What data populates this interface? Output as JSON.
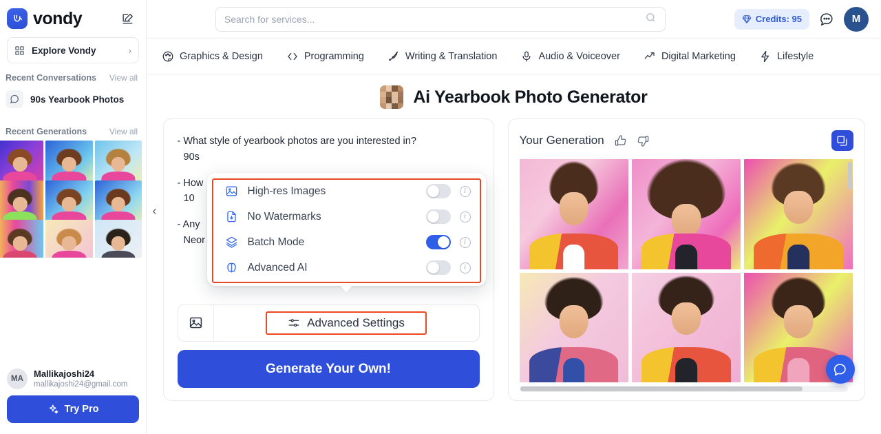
{
  "sidebar": {
    "brand_name": "vondy",
    "compose_icon": "compose-icon",
    "explore": {
      "label": "Explore Vondy",
      "icon": "grid-icon",
      "chevron": "›"
    },
    "recent_conversations": {
      "title": "Recent Conversations",
      "view_all": "View all"
    },
    "conversations": [
      {
        "label": "90s Yearbook Photos",
        "icon": "chat-bubble-icon"
      }
    ],
    "recent_generations": {
      "title": "Recent Generations",
      "view_all": "View all"
    },
    "generation_thumbs": [
      {
        "bg": "linear-gradient(135deg,#3b2fd0,#8a3fd8 45%,#e93fa0)",
        "hair": "#8a4a24",
        "jacket": "#e8489c",
        "shirt": "#f2d23a"
      },
      {
        "bg": "linear-gradient(135deg,#2b63d8,#6cc6ee 60%,#f2f6a0)",
        "hair": "#6e3d20",
        "jacket": "#e8489c",
        "shirt": "#e4607f"
      },
      {
        "bg": "linear-gradient(135deg,#6fc3ea,#bfe7f6 55%,#f6f0a6)",
        "hair": "#b4813f",
        "jacket": "#e8489c",
        "shirt": "#2a2a33"
      },
      {
        "bg": "linear-gradient(90deg,#f4c84a,#e8489c 35%,#7b4ad6 70%,#f6a23c)",
        "hair": "#4c3220",
        "jacket": "#8ce05a",
        "shirt": "#8ce05a"
      },
      {
        "bg": "linear-gradient(135deg,#2b63d8,#7fd0f0 55%,#f6f0a6)",
        "hair": "#7a4423",
        "jacket": "#e8489c",
        "shirt": "#f2d23a"
      },
      {
        "bg": "linear-gradient(135deg,#2b63d8,#8fd8f2 60%,#f6f0a6)",
        "hair": "#6b3a1e",
        "jacket": "#e8489c",
        "shirt": "#f2d23a"
      },
      {
        "bg": "linear-gradient(90deg,#f4c84a,#e8489c 40%,#6ec6ef)",
        "hair": "#5a3a22",
        "jacket": "#d9486f",
        "shirt": "#f2d23a"
      },
      {
        "bg": "linear-gradient(135deg,#f7e9b8,#f2c0d8)",
        "hair": "#c98b4a",
        "jacket": "#e8489c",
        "shirt": "#f2d23a"
      },
      {
        "bg": "linear-gradient(135deg,#cfe6f5,#f0f2f5)",
        "hair": "#2a2118",
        "jacket": "#4a4a58",
        "shirt": "#8a8a99"
      }
    ],
    "user": {
      "initials": "MA",
      "name": "Mallikajoshi24",
      "email": "mallikajoshi24@gmail.com"
    },
    "try_pro": {
      "label": "Try Pro",
      "icon": "sparkle-icon"
    },
    "collapse_icon": "chevron-left-icon"
  },
  "topbar": {
    "search": {
      "placeholder": "Search for services...",
      "value": "",
      "icon": "search-icon"
    },
    "credits": {
      "label": "Credits: 95",
      "icon": "diamond-icon"
    },
    "chat_icon": "chat-bubble-icon",
    "avatar_initial": "M"
  },
  "nav": {
    "items": [
      {
        "label": "Graphics & Design",
        "icon": "palette-icon"
      },
      {
        "label": "Programming",
        "icon": "code-icon"
      },
      {
        "label": "Writing & Translation",
        "icon": "pen-nib-icon"
      },
      {
        "label": "Audio & Voiceover",
        "icon": "microphone-icon"
      },
      {
        "label": "Digital Marketing",
        "icon": "trending-up-icon"
      },
      {
        "label": "Lifestyle",
        "icon": "lightning-icon"
      }
    ]
  },
  "page": {
    "title": "Ai Yearbook Photo Generator",
    "title_thumb_icon": "yearbook-collage-icon"
  },
  "left_panel": {
    "qa": [
      {
        "question": "- What style of yearbook photos are you interested in?",
        "answer": "90s"
      },
      {
        "question": "- How",
        "answer": "10"
      },
      {
        "question": "- Any",
        "answer": "Neor"
      }
    ],
    "image_tool_icon": "image-icon",
    "advanced_settings": {
      "label": "Advanced Settings",
      "icon": "sliders-icon"
    },
    "generate_button": "Generate Your Own!"
  },
  "popover": {
    "options": [
      {
        "label": "High-res Images",
        "icon": "image-icon",
        "enabled": false,
        "info_icon": "info-icon"
      },
      {
        "label": "No Watermarks",
        "icon": "file-download-icon",
        "enabled": false,
        "info_icon": "info-icon"
      },
      {
        "label": "Batch Mode",
        "icon": "layers-icon",
        "enabled": true,
        "info_icon": "info-icon"
      },
      {
        "label": "Advanced AI",
        "icon": "brain-icon",
        "enabled": false,
        "info_icon": "info-icon"
      }
    ]
  },
  "right_panel": {
    "title": "Your Generation",
    "thumbs_up_icon": "thumbs-up-icon",
    "thumbs_down_icon": "thumbs-down-icon",
    "copy_icon": "copy-icon",
    "images": [
      {
        "bg": "linear-gradient(130deg,#f3b8d6 0%,#f6c9dd 35%,#e970b8 70%,#f2a6cf 100%)",
        "hair": "#4a2d1c",
        "jacket": "#e8553f",
        "collar": "#f4c42e",
        "shirt": "#ffffff"
      },
      {
        "bg": "linear-gradient(130deg,#ef8fc8 0%,#f4b4d8 40%,#ee6cbb 75%,#eded7a 100%)",
        "hair": "#4a2d1c",
        "jacket": "#e8489c",
        "collar": "#f4c42e",
        "shirt": "#23232b"
      },
      {
        "bg": "linear-gradient(130deg,#ec4fb0 0%,#e9f06a 45%,#ef6fc0 100%)",
        "hair": "#5a3a22",
        "jacket": "#f2a528",
        "collar": "#ef6a2e",
        "shirt": "#24315e"
      },
      {
        "bg": "linear-gradient(130deg,#f5e9b4 0%,#f4cadf 45%,#f0bcd8 100%)",
        "hair": "#2f2018",
        "jacket": "#e06a86",
        "collar": "#3c4a9e",
        "shirt": "#3350a8"
      },
      {
        "bg": "linear-gradient(130deg,#f5cfe2 0%,#f3bdd9 50%,#f0aed2 100%)",
        "hair": "#35231a",
        "jacket": "#e8553f",
        "collar": "#f4c42e",
        "shirt": "#23232b"
      },
      {
        "bg": "linear-gradient(130deg,#ec4fb0 0%,#e9f06a 50%,#ee62ba 100%)",
        "hair": "#3a2518",
        "jacket": "#e0647f",
        "collar": "#f4c42e",
        "shirt": "#f0a5bd"
      }
    ],
    "fab_icon": "chat-bubble-icon"
  },
  "colors": {
    "brand_blue": "#2f4fdb",
    "toggle_on": "#2f5fe8",
    "highlight_red": "#ea4823",
    "credits_bg": "#e6edfd",
    "credits_text": "#2f5bd8"
  }
}
